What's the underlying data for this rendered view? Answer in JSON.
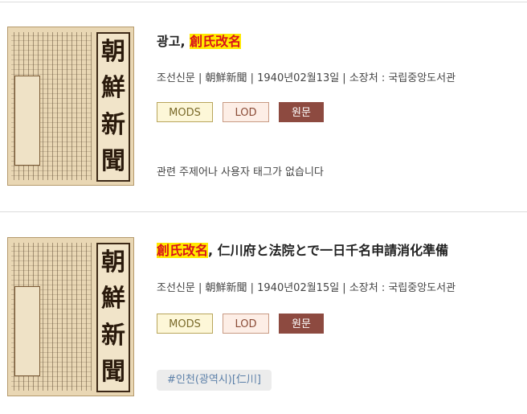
{
  "results": [
    {
      "title_pre": "광고, ",
      "title_highlight": "創氏改名",
      "title_post": "",
      "meta": "조선신문 | 朝鮮新聞 | 1940년02월13일 | 소장처 : 국립중앙도서관",
      "buttons": {
        "mods": "MODS",
        "lod": "LOD",
        "original": "원문"
      },
      "no_tags_text": "관련 주제어나 사용자 태그가 없습니다",
      "thumbnail_masthead": [
        "朝",
        "鮮",
        "新",
        "聞"
      ]
    },
    {
      "title_pre": "",
      "title_highlight": "創氏改名",
      "title_post": ", 仁川府と法院とで一日千名申請消化準備",
      "meta": "조선신문 | 朝鮮新聞 | 1940년02월15일 | 소장처 : 국립중앙도서관",
      "buttons": {
        "mods": "MODS",
        "lod": "LOD",
        "original": "원문"
      },
      "tags": [
        "#인천(광역시)[仁川]"
      ],
      "thumbnail_masthead": [
        "朝",
        "鮮",
        "新",
        "聞"
      ]
    }
  ],
  "colors": {
    "highlight_bg": "#ffea00",
    "highlight_text": "#d9121b",
    "original_button": "#8d4a40",
    "tag_text": "#5b7fa8"
  }
}
